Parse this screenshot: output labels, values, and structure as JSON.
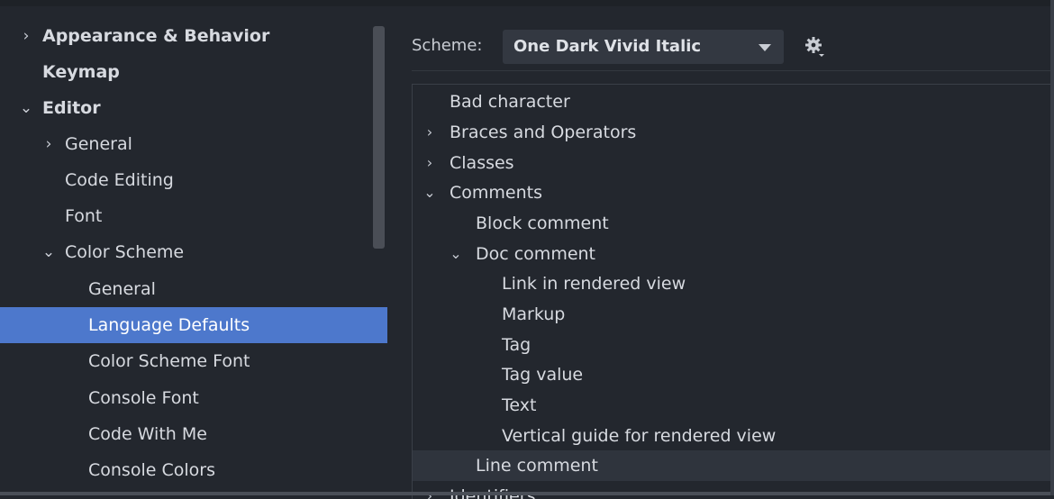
{
  "sidebar": {
    "items": [
      {
        "label": "Appearance & Behavior",
        "chevron": "›",
        "expanded": false,
        "bold": true,
        "level": 0
      },
      {
        "label": "Keymap",
        "chevron": "",
        "expanded": false,
        "bold": true,
        "level": 0
      },
      {
        "label": "Editor",
        "chevron": "⌄",
        "expanded": true,
        "bold": true,
        "level": 0
      },
      {
        "label": "General",
        "chevron": "›",
        "expanded": false,
        "bold": false,
        "level": 1
      },
      {
        "label": "Code Editing",
        "chevron": "",
        "expanded": false,
        "bold": false,
        "level": 1
      },
      {
        "label": "Font",
        "chevron": "",
        "expanded": false,
        "bold": false,
        "level": 1
      },
      {
        "label": "Color Scheme",
        "chevron": "⌄",
        "expanded": true,
        "bold": false,
        "level": 1
      },
      {
        "label": "General",
        "chevron": "",
        "expanded": false,
        "bold": false,
        "level": 2
      },
      {
        "label": "Language Defaults",
        "chevron": "",
        "expanded": false,
        "bold": false,
        "level": 2,
        "selected": true
      },
      {
        "label": "Color Scheme Font",
        "chevron": "",
        "expanded": false,
        "bold": false,
        "level": 2
      },
      {
        "label": "Console Font",
        "chevron": "",
        "expanded": false,
        "bold": false,
        "level": 2
      },
      {
        "label": "Code With Me",
        "chevron": "",
        "expanded": false,
        "bold": false,
        "level": 2
      },
      {
        "label": "Console Colors",
        "chevron": "",
        "expanded": false,
        "bold": false,
        "level": 2
      }
    ]
  },
  "scheme": {
    "label": "Scheme:",
    "value": "One Dark Vivid Italic",
    "settings_icon": "gear-icon"
  },
  "attributes": {
    "rows": [
      {
        "label": "Bad character",
        "chevron": "",
        "level": 0
      },
      {
        "label": "Braces and Operators",
        "chevron": "›",
        "level": 0
      },
      {
        "label": "Classes",
        "chevron": "›",
        "level": 0
      },
      {
        "label": "Comments",
        "chevron": "⌄",
        "level": 0
      },
      {
        "label": "Block comment",
        "chevron": "",
        "level": 1
      },
      {
        "label": "Doc comment",
        "chevron": "⌄",
        "level": 1
      },
      {
        "label": "Link in rendered view",
        "chevron": "",
        "level": 2
      },
      {
        "label": "Markup",
        "chevron": "",
        "level": 2
      },
      {
        "label": "Tag",
        "chevron": "",
        "level": 2
      },
      {
        "label": "Tag value",
        "chevron": "",
        "level": 2
      },
      {
        "label": "Text",
        "chevron": "",
        "level": 2
      },
      {
        "label": "Vertical guide for rendered view",
        "chevron": "",
        "level": 2
      },
      {
        "label": "Line comment",
        "chevron": "",
        "level": 1,
        "highlighted": true
      },
      {
        "label": "Identifiers",
        "chevron": "›",
        "level": 0
      }
    ]
  },
  "colors": {
    "selection": "#4d78cc",
    "background": "#23272e"
  }
}
